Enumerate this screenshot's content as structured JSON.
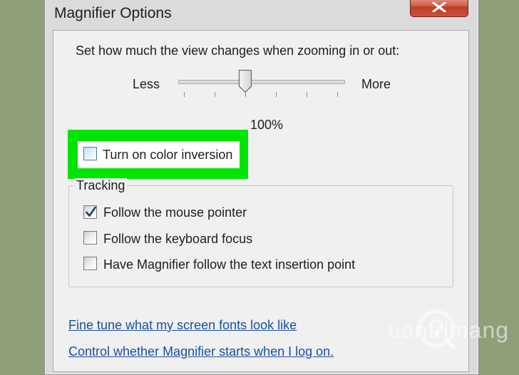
{
  "window": {
    "title": "Magnifier Options"
  },
  "zoom": {
    "instruction": "Set how much the view changes when zooming in or out:",
    "less_label": "Less",
    "more_label": "More",
    "value_label": "100%",
    "slider_level": 0.4
  },
  "color_inversion": {
    "label": "Turn on color inversion",
    "checked": false
  },
  "tracking": {
    "group_label": "Tracking",
    "options": [
      {
        "label": "Follow the mouse pointer",
        "checked": true
      },
      {
        "label": "Follow the keyboard focus",
        "checked": false
      },
      {
        "label": "Have Magnifier follow the text insertion point",
        "checked": false
      }
    ]
  },
  "links": {
    "fonts": "Fine tune what my screen fonts look like",
    "startup": "Control whether Magnifier starts when I log on."
  },
  "watermark": {
    "text": "uantrimang"
  },
  "colors": {
    "highlight": "#00e400",
    "link": "#1a4fa8",
    "close_button": "#c9533a"
  },
  "icons": {
    "close": "close-icon",
    "check": "checkmark-icon",
    "watermark_logo": "lightbulb-icon"
  }
}
